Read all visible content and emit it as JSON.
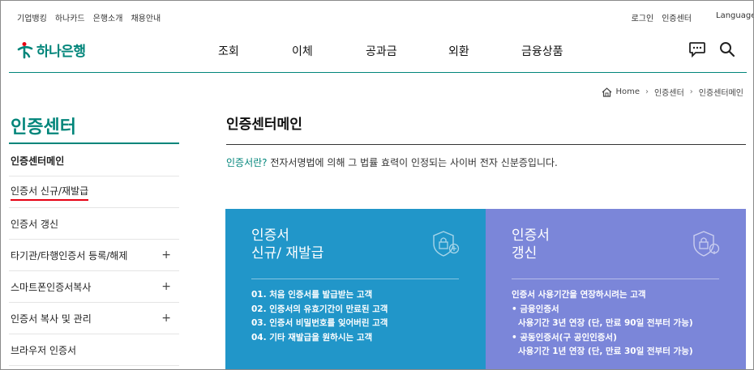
{
  "util": {
    "left": [
      "기업뱅킹",
      "하나카드",
      "은행소개",
      "채용안내"
    ],
    "login": "로그인",
    "cert_center": "인증센터",
    "language": "Language"
  },
  "logo": {
    "text": "하나은행"
  },
  "gnb": [
    "조회",
    "이체",
    "공과금",
    "외환",
    "금융상품"
  ],
  "icons": {
    "chat": "chat-icon",
    "search": "search-icon",
    "home": "home-icon",
    "lock": "lock-shield-icon"
  },
  "breadcrumb": {
    "home": "Home",
    "level1": "인증센터",
    "level2": "인증센터메인"
  },
  "lnb": {
    "title": "인증센터",
    "items": [
      {
        "label": "인증센터메인",
        "plus": ""
      },
      {
        "label": "인증서 신규/재발급",
        "plus": ""
      },
      {
        "label": "인증서 갱신",
        "plus": ""
      },
      {
        "label": "타기관/타행인증서 등록/해제",
        "plus": "+"
      },
      {
        "label": "스마트폰인증서복사",
        "plus": "+"
      },
      {
        "label": "인증서 복사 및 관리",
        "plus": "+"
      },
      {
        "label": "브라우저 인증서",
        "plus": ""
      }
    ]
  },
  "content": {
    "title": "인증센터메인",
    "desc_highlight": "인증서란?",
    "desc_text": " 전자서명법에 의해 그 법률 효력이 인정되는 사이버 전자 신분증입니다."
  },
  "cards": [
    {
      "title1": "인증서",
      "title2": "신규/ 재발급",
      "items": [
        "01. 처음 인증서를 발급받는 고객",
        "02. 인증서의 유효기간이 만료된 고객",
        "03. 인증서 비밀번호를 잊어버린 고객",
        "04. 기타 재발급을 원하시는 고객"
      ]
    },
    {
      "title1": "인증서",
      "title2": "갱신",
      "items": [
        "인증서 사용기간을 연장하시려는 고객",
        "• 금융인증서",
        "사용기간 3년 연장 (단, 만료 90일 전부터 가능)",
        "• 공동인증서(구 공인인증서)",
        "사용기간 1년 연장 (단, 만료 30일 전부터 가능)"
      ]
    }
  ],
  "colors": {
    "brand": "#00857a",
    "card1": "#2196c9",
    "card2": "#7b86d9",
    "accent_red": "#e60012"
  }
}
